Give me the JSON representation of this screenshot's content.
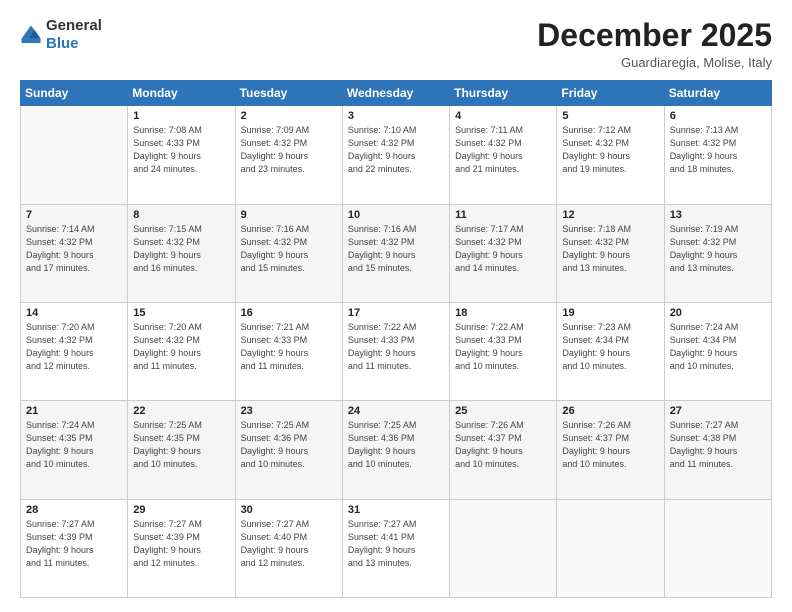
{
  "logo": {
    "general": "General",
    "blue": "Blue"
  },
  "header": {
    "month": "December 2025",
    "location": "Guardiaregia, Molise, Italy"
  },
  "weekdays": [
    "Sunday",
    "Monday",
    "Tuesday",
    "Wednesday",
    "Thursday",
    "Friday",
    "Saturday"
  ],
  "weeks": [
    [
      {
        "day": "",
        "info": ""
      },
      {
        "day": "1",
        "info": "Sunrise: 7:08 AM\nSunset: 4:33 PM\nDaylight: 9 hours\nand 24 minutes."
      },
      {
        "day": "2",
        "info": "Sunrise: 7:09 AM\nSunset: 4:32 PM\nDaylight: 9 hours\nand 23 minutes."
      },
      {
        "day": "3",
        "info": "Sunrise: 7:10 AM\nSunset: 4:32 PM\nDaylight: 9 hours\nand 22 minutes."
      },
      {
        "day": "4",
        "info": "Sunrise: 7:11 AM\nSunset: 4:32 PM\nDaylight: 9 hours\nand 21 minutes."
      },
      {
        "day": "5",
        "info": "Sunrise: 7:12 AM\nSunset: 4:32 PM\nDaylight: 9 hours\nand 19 minutes."
      },
      {
        "day": "6",
        "info": "Sunrise: 7:13 AM\nSunset: 4:32 PM\nDaylight: 9 hours\nand 18 minutes."
      }
    ],
    [
      {
        "day": "7",
        "info": "Sunrise: 7:14 AM\nSunset: 4:32 PM\nDaylight: 9 hours\nand 17 minutes."
      },
      {
        "day": "8",
        "info": "Sunrise: 7:15 AM\nSunset: 4:32 PM\nDaylight: 9 hours\nand 16 minutes."
      },
      {
        "day": "9",
        "info": "Sunrise: 7:16 AM\nSunset: 4:32 PM\nDaylight: 9 hours\nand 15 minutes."
      },
      {
        "day": "10",
        "info": "Sunrise: 7:16 AM\nSunset: 4:32 PM\nDaylight: 9 hours\nand 15 minutes."
      },
      {
        "day": "11",
        "info": "Sunrise: 7:17 AM\nSunset: 4:32 PM\nDaylight: 9 hours\nand 14 minutes."
      },
      {
        "day": "12",
        "info": "Sunrise: 7:18 AM\nSunset: 4:32 PM\nDaylight: 9 hours\nand 13 minutes."
      },
      {
        "day": "13",
        "info": "Sunrise: 7:19 AM\nSunset: 4:32 PM\nDaylight: 9 hours\nand 13 minutes."
      }
    ],
    [
      {
        "day": "14",
        "info": "Sunrise: 7:20 AM\nSunset: 4:32 PM\nDaylight: 9 hours\nand 12 minutes."
      },
      {
        "day": "15",
        "info": "Sunrise: 7:20 AM\nSunset: 4:32 PM\nDaylight: 9 hours\nand 11 minutes."
      },
      {
        "day": "16",
        "info": "Sunrise: 7:21 AM\nSunset: 4:33 PM\nDaylight: 9 hours\nand 11 minutes."
      },
      {
        "day": "17",
        "info": "Sunrise: 7:22 AM\nSunset: 4:33 PM\nDaylight: 9 hours\nand 11 minutes."
      },
      {
        "day": "18",
        "info": "Sunrise: 7:22 AM\nSunset: 4:33 PM\nDaylight: 9 hours\nand 10 minutes."
      },
      {
        "day": "19",
        "info": "Sunrise: 7:23 AM\nSunset: 4:34 PM\nDaylight: 9 hours\nand 10 minutes."
      },
      {
        "day": "20",
        "info": "Sunrise: 7:24 AM\nSunset: 4:34 PM\nDaylight: 9 hours\nand 10 minutes."
      }
    ],
    [
      {
        "day": "21",
        "info": "Sunrise: 7:24 AM\nSunset: 4:35 PM\nDaylight: 9 hours\nand 10 minutes."
      },
      {
        "day": "22",
        "info": "Sunrise: 7:25 AM\nSunset: 4:35 PM\nDaylight: 9 hours\nand 10 minutes."
      },
      {
        "day": "23",
        "info": "Sunrise: 7:25 AM\nSunset: 4:36 PM\nDaylight: 9 hours\nand 10 minutes."
      },
      {
        "day": "24",
        "info": "Sunrise: 7:25 AM\nSunset: 4:36 PM\nDaylight: 9 hours\nand 10 minutes."
      },
      {
        "day": "25",
        "info": "Sunrise: 7:26 AM\nSunset: 4:37 PM\nDaylight: 9 hours\nand 10 minutes."
      },
      {
        "day": "26",
        "info": "Sunrise: 7:26 AM\nSunset: 4:37 PM\nDaylight: 9 hours\nand 10 minutes."
      },
      {
        "day": "27",
        "info": "Sunrise: 7:27 AM\nSunset: 4:38 PM\nDaylight: 9 hours\nand 11 minutes."
      }
    ],
    [
      {
        "day": "28",
        "info": "Sunrise: 7:27 AM\nSunset: 4:39 PM\nDaylight: 9 hours\nand 11 minutes."
      },
      {
        "day": "29",
        "info": "Sunrise: 7:27 AM\nSunset: 4:39 PM\nDaylight: 9 hours\nand 12 minutes."
      },
      {
        "day": "30",
        "info": "Sunrise: 7:27 AM\nSunset: 4:40 PM\nDaylight: 9 hours\nand 12 minutes."
      },
      {
        "day": "31",
        "info": "Sunrise: 7:27 AM\nSunset: 4:41 PM\nDaylight: 9 hours\nand 13 minutes."
      },
      {
        "day": "",
        "info": ""
      },
      {
        "day": "",
        "info": ""
      },
      {
        "day": "",
        "info": ""
      }
    ]
  ]
}
